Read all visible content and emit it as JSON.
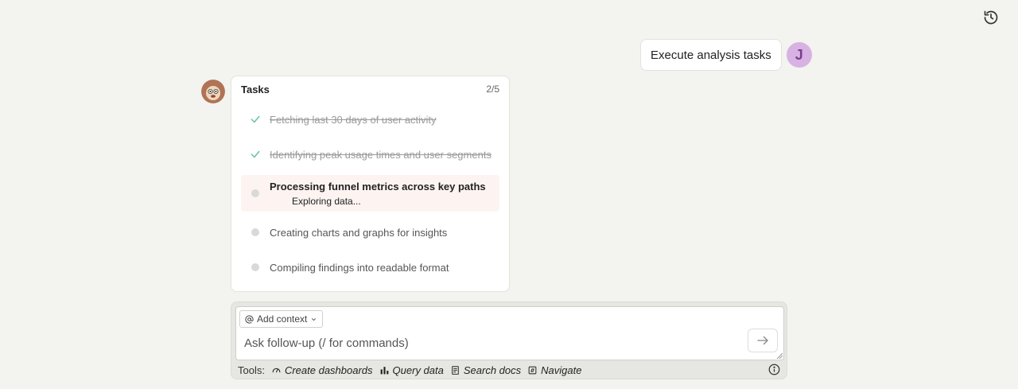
{
  "icons": {
    "history": "history-icon",
    "check": "check-icon",
    "send": "arrow-right-icon",
    "info": "info-icon",
    "at": "at-icon",
    "chevron": "chevron-down-icon"
  },
  "colors": {
    "background": "#f3f3ef",
    "check": "#62c49a",
    "user_avatar_bg": "#d8b2e2",
    "active_task_bg": "#fdf4f2"
  },
  "conversation": {
    "user_message": "Execute analysis tasks",
    "user_initial": "J"
  },
  "tasks": {
    "title": "Tasks",
    "count": "2/5",
    "items": [
      {
        "label": "Fetching last 30 days of user activity",
        "status": "done"
      },
      {
        "label": "Identifying peak usage times and user segments",
        "status": "done"
      },
      {
        "label": "Processing funnel metrics across key paths",
        "status": "active",
        "sub": "Exploring data..."
      },
      {
        "label": "Creating charts and graphs for insights",
        "status": "pending"
      },
      {
        "label": "Compiling findings into readable format",
        "status": "pending"
      }
    ]
  },
  "composer": {
    "add_context": "Add context",
    "placeholder": "Ask follow-up (/ for commands)",
    "tools_label": "Tools:",
    "tools": [
      {
        "label": "Create dashboards",
        "icon": "dashboard-icon"
      },
      {
        "label": "Query data",
        "icon": "bar-chart-icon"
      },
      {
        "label": "Search docs",
        "icon": "document-icon"
      },
      {
        "label": "Navigate",
        "icon": "compass-icon"
      }
    ]
  }
}
